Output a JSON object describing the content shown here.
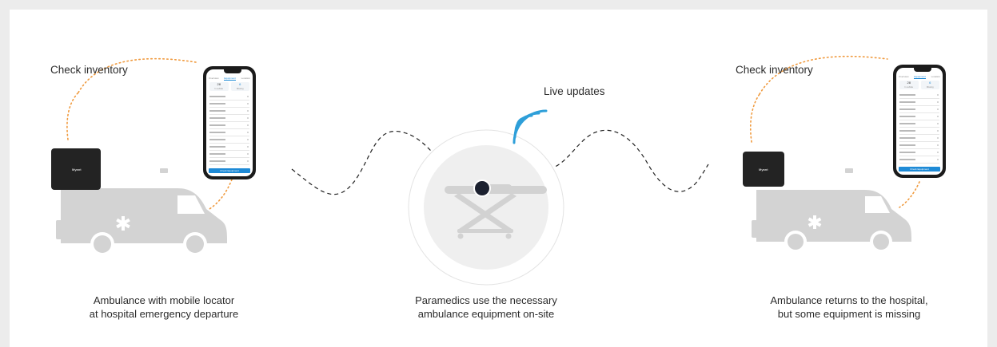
{
  "labels": {
    "check_inventory_left": "Check inventory",
    "check_inventory_right": "Check inventory",
    "live_updates": "Live updates"
  },
  "captions": {
    "left": {
      "line1": "Ambulance with mobile locator",
      "line2": "at hospital emergency departure"
    },
    "center": {
      "line1": "Paramedics use the necessary",
      "line2": "ambulance equipment on-site"
    },
    "right": {
      "line1": "Ambulance returns to the hospital,",
      "line2": "but some equipment is missing"
    }
  },
  "phone": {
    "tabs": [
      "Overview",
      "Equipment",
      "Location"
    ],
    "stats": [
      {
        "value": "28",
        "label": "In vehicle"
      },
      {
        "value": "6",
        "label": "Missing"
      }
    ],
    "button": "Check Equipment"
  },
  "device": {
    "logo": "Myant"
  },
  "colors": {
    "accent_orange": "#f09a3e",
    "wifi_blue": "#2e9fd9",
    "ambulance_gray": "#d3d3d3",
    "dash": "#222222"
  },
  "icons": [
    "ambulance-icon",
    "stretcher-icon",
    "wifi-signal-icon",
    "phone-icon",
    "locator-device-icon"
  ]
}
